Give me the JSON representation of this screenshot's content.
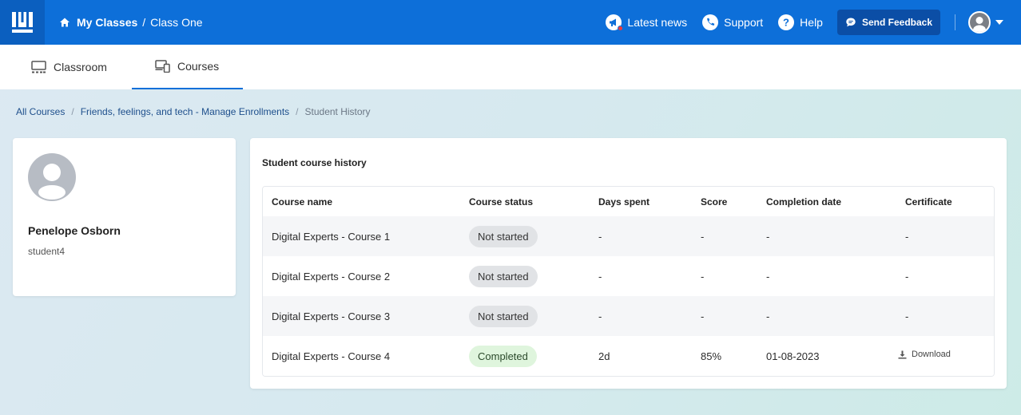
{
  "header": {
    "breadcrumb": [
      "My Classes",
      "Class One"
    ],
    "breadcrumb_sep": "/",
    "links": [
      {
        "label": "Latest news",
        "icon": "megaphone-icon"
      },
      {
        "label": "Support",
        "icon": "phone-icon"
      },
      {
        "label": "Help",
        "icon": "help-icon"
      }
    ],
    "feedback_label": "Send Feedback"
  },
  "tabs": [
    {
      "label": "Classroom",
      "icon": "classroom-icon",
      "active": false
    },
    {
      "label": "Courses",
      "icon": "devices-icon",
      "active": true
    }
  ],
  "breadcrumb": {
    "items": [
      "All Courses",
      "Friends, feelings, and tech - Manage Enrollments"
    ],
    "current": "Student History",
    "sep": "/"
  },
  "student": {
    "name": "Penelope Osborn",
    "username": "student4"
  },
  "history": {
    "title": "Student course history",
    "columns": [
      "Course name",
      "Course status",
      "Days spent",
      "Score",
      "Completion date",
      "Certificate"
    ],
    "rows": [
      {
        "course": "Digital Experts - Course 1",
        "status": "Not started",
        "days": "-",
        "score": "-",
        "date": "-",
        "certificate": "-"
      },
      {
        "course": "Digital Experts - Course 2",
        "status": "Not started",
        "days": "-",
        "score": "-",
        "date": "-",
        "certificate": "-"
      },
      {
        "course": "Digital Experts - Course 3",
        "status": "Not started",
        "days": "-",
        "score": "-",
        "date": "-",
        "certificate": "-"
      },
      {
        "course": "Digital Experts - Course 4",
        "status": "Completed",
        "days": "2d",
        "score": "85%",
        "date": "01-08-2023",
        "certificate": "Download"
      }
    ]
  },
  "colors": {
    "brand": "#0d6fd9",
    "brand_dark": "#0b4ea6",
    "completed": "#dff5dd",
    "not_started": "#e1e3e6"
  }
}
